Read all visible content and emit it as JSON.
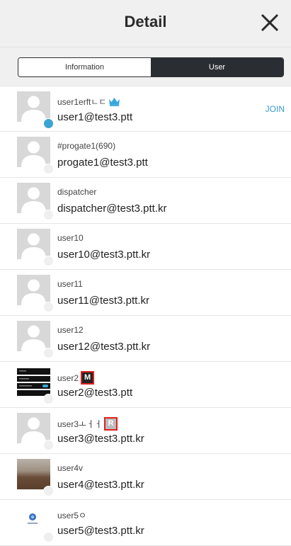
{
  "header": {
    "title": "Detail"
  },
  "tabs": {
    "information": "Information",
    "user": "User"
  },
  "users": [
    {
      "nick": "user1erftㄴㄷ",
      "email": "user1@test3.ptt",
      "online": true,
      "crown": true,
      "action": "JOIN"
    },
    {
      "nick": "#progate1(690)",
      "email": "progate1@test3.ptt"
    },
    {
      "nick": "dispatcher",
      "email": "dispatcher@test3.ptt.kr"
    },
    {
      "nick": "user10",
      "email": "user10@test3.ptt.kr"
    },
    {
      "nick": "user11",
      "email": "user11@test3.ptt.kr"
    },
    {
      "nick": "user12",
      "email": "user12@test3.ptt.kr"
    },
    {
      "nick": "user2",
      "email": "user2@test3.ptt",
      "badge": "M"
    },
    {
      "nick": "user3ㅗㅓㅓ",
      "email": "user3@test3.ptt.kr",
      "badge": "R"
    },
    {
      "nick": "user4v",
      "email": "user4@test3.ptt.kr"
    },
    {
      "nick": "user5ㅇ",
      "email": "user5@test3.ptt.kr"
    }
  ]
}
